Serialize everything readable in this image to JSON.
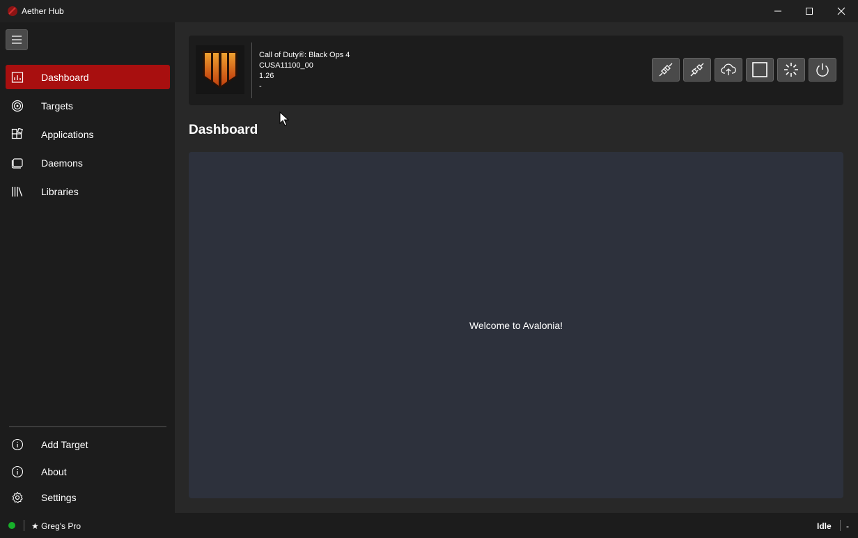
{
  "window": {
    "title": "Aether Hub",
    "minimize_icon": "minimize-icon",
    "maximize_icon": "maximize-icon",
    "close_icon": "close-icon",
    "accent_color": "#a80f0f"
  },
  "sidebar": {
    "menu_icon": "hamburger-icon",
    "items": [
      {
        "label": "Dashboard",
        "icon": "chart-icon",
        "active": true
      },
      {
        "label": "Targets",
        "icon": "target-icon"
      },
      {
        "label": "Applications",
        "icon": "apps-icon"
      },
      {
        "label": "Daemons",
        "icon": "stack-icon"
      },
      {
        "label": "Libraries",
        "icon": "library-icon"
      }
    ],
    "footer_items": [
      {
        "label": "Add Target",
        "icon": "info-icon"
      },
      {
        "label": "About",
        "icon": "info-icon"
      },
      {
        "label": "Settings",
        "icon": "gear-icon"
      }
    ]
  },
  "header": {
    "game_title": "Call of Duty®: Black Ops 4",
    "title_id": "CUSA11100_00",
    "version": "1.26",
    "extra": "-",
    "toolbar": [
      {
        "name": "connect-button",
        "icon": "plug-connect-icon"
      },
      {
        "name": "disconnect-button",
        "icon": "plug-disconnect-icon"
      },
      {
        "name": "upload-button",
        "icon": "cloud-upload-icon"
      },
      {
        "name": "stop-button",
        "icon": "square-icon"
      },
      {
        "name": "loading-button",
        "icon": "spinner-icon"
      },
      {
        "name": "power-button",
        "icon": "power-icon"
      }
    ]
  },
  "page": {
    "title": "Dashboard",
    "welcome": "Welcome to Avalonia!"
  },
  "statusbar": {
    "connection_color": "#17b02a",
    "target_label": "★ Greg's Pro",
    "state": "Idle",
    "extra": "-"
  }
}
